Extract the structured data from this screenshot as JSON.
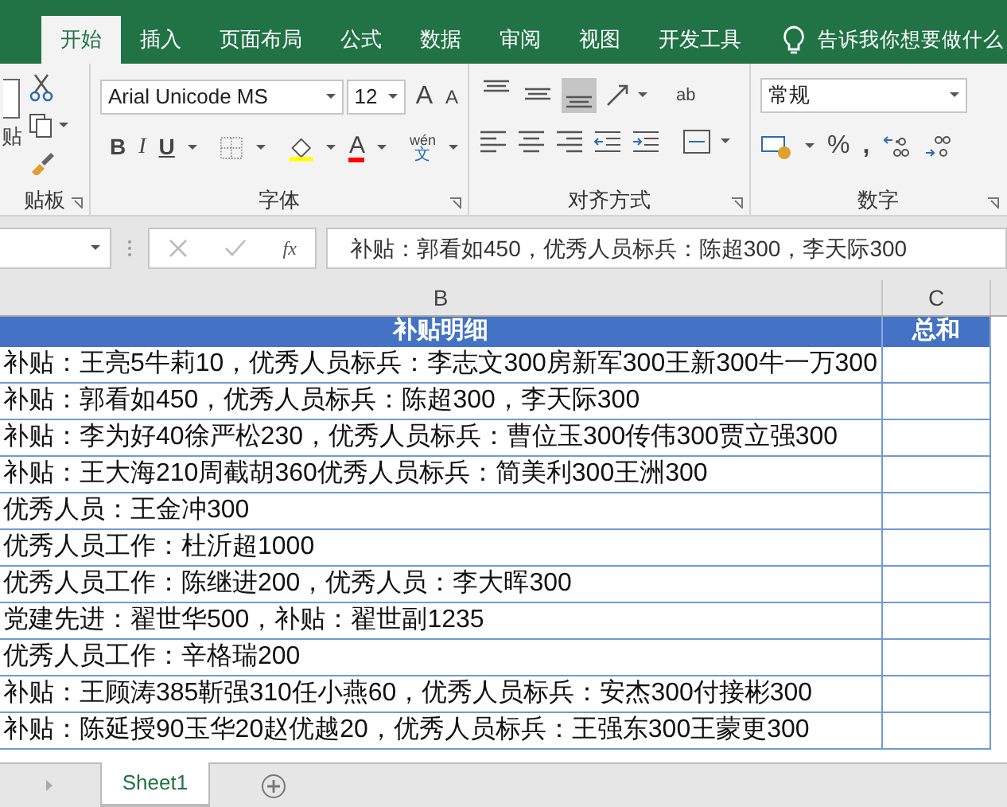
{
  "ribbon_tabs": [
    {
      "label": "开始",
      "selected": true
    },
    {
      "label": "插入",
      "selected": false
    },
    {
      "label": "页面布局",
      "selected": false
    },
    {
      "label": "公式",
      "selected": false
    },
    {
      "label": "数据",
      "selected": false
    },
    {
      "label": "审阅",
      "selected": false
    },
    {
      "label": "视图",
      "selected": false
    },
    {
      "label": "开发工具",
      "selected": false
    }
  ],
  "tell_me": "告诉我你想要做什么",
  "clipboard": {
    "paste_label": "贴",
    "group_label": "贴板"
  },
  "font": {
    "name": "Arial Unicode MS",
    "size": "12",
    "group_label": "字体",
    "phonetic_top": "wén",
    "phonetic_bottom": "文",
    "bold": "B",
    "italic": "I",
    "underline": "U",
    "grow": "A",
    "shrink": "A",
    "font_color_letter": "A"
  },
  "alignment": {
    "group_label": "对齐方式",
    "buttons": [
      {
        "kind": "top",
        "selected": false
      },
      {
        "kind": "middle",
        "selected": false
      },
      {
        "kind": "bottom",
        "selected": true
      }
    ],
    "wrap_label": "ab"
  },
  "number": {
    "format": "常规",
    "group_label": "数字",
    "percent": "%",
    "comma": ","
  },
  "formula_bar": {
    "fx": "fx",
    "value": "补贴：郭看如450，优秀人员标兵：陈超300，李天际300"
  },
  "column_headers": [
    "B",
    "C"
  ],
  "table": {
    "columns": [
      "补贴明细",
      "总和"
    ],
    "rows": [
      [
        "补贴：王亮5牛莉10，优秀人员标兵：李志文300房新军300王新300牛一万300"
      ],
      [
        "补贴：郭看如450，优秀人员标兵：陈超300，李天际300"
      ],
      [
        "补贴：李为好40徐严松230，优秀人员标兵：曹位玉300传伟300贾立强300"
      ],
      [
        "补贴：王大海210周截胡360优秀人员标兵：简美利300王洲300"
      ],
      [
        "优秀人员：王金冲300"
      ],
      [
        "优秀人员工作：杜沂超1000"
      ],
      [
        "优秀人员工作：陈继进200，优秀人员：李大晖300"
      ],
      [
        "党建先进：翟世华500，补贴：翟世副1235"
      ],
      [
        "优秀人员工作：辛格瑞200"
      ],
      [
        "补贴：王顾涛385靳强310任小燕60，优秀人员标兵：安杰300付接彬300"
      ],
      [
        "补贴：陈延授90玉华20赵优越20，优秀人员标兵：王强东300王蒙更300"
      ]
    ]
  },
  "sheet_tabs": [
    {
      "label": "Sheet1",
      "selected": true
    }
  ]
}
